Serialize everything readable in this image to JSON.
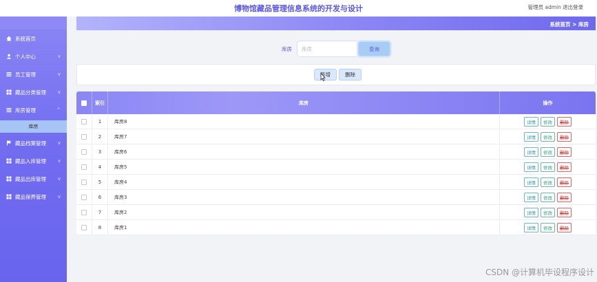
{
  "app": {
    "title": "博物馆藏品管理信息系统的开发与设计",
    "user_label": "管理员 admin",
    "logout_label": "退出登录"
  },
  "sidebar": {
    "items": [
      {
        "label": "系统首页",
        "icon": "home-icon"
      },
      {
        "label": "个人中心",
        "icon": "person-icon",
        "chevron": "v"
      },
      {
        "label": "员工管理",
        "icon": "list-icon",
        "chevron": "v"
      },
      {
        "label": "藏品分类管理",
        "icon": "grid-icon",
        "chevron": "v"
      },
      {
        "label": "库房管理",
        "icon": "list-icon",
        "chevron": "^"
      },
      {
        "label": "藏品档案管理",
        "icon": "flag-icon",
        "chevron": "v"
      },
      {
        "label": "藏品入库管理",
        "icon": "grid-icon",
        "chevron": "v"
      },
      {
        "label": "藏品出库管理",
        "icon": "grid-icon",
        "chevron": "v"
      },
      {
        "label": "藏品保养管理",
        "icon": "grid-icon",
        "chevron": "v"
      }
    ],
    "subitem": "库房"
  },
  "breadcrumb": {
    "home": "系统首页",
    "separator": ">",
    "current": "库房"
  },
  "search": {
    "label": "库房",
    "placeholder": "库房",
    "button": "查询"
  },
  "actions": {
    "add": "新增",
    "delete": "删除"
  },
  "table": {
    "headers": {
      "index": "索引",
      "name": "库房",
      "ops": "操作"
    },
    "ops": {
      "detail": "详情",
      "edit": "修改",
      "delete": "删除"
    },
    "rows": [
      {
        "idx": "1",
        "name": "库房8"
      },
      {
        "idx": "2",
        "name": "库房7"
      },
      {
        "idx": "3",
        "name": "库房6"
      },
      {
        "idx": "4",
        "name": "库房5"
      },
      {
        "idx": "5",
        "name": "库房4"
      },
      {
        "idx": "6",
        "name": "库房3"
      },
      {
        "idx": "7",
        "name": "库房2"
      },
      {
        "idx": "8",
        "name": "库房1"
      }
    ]
  },
  "watermark": "CSDN @计算机毕设程序设计",
  "colors": {
    "accent": "#716cf0",
    "title": "#5b57e6",
    "submenu": "#a6c4f6",
    "search_button": "#a8ccf4",
    "op_delete": "#cc3333"
  }
}
